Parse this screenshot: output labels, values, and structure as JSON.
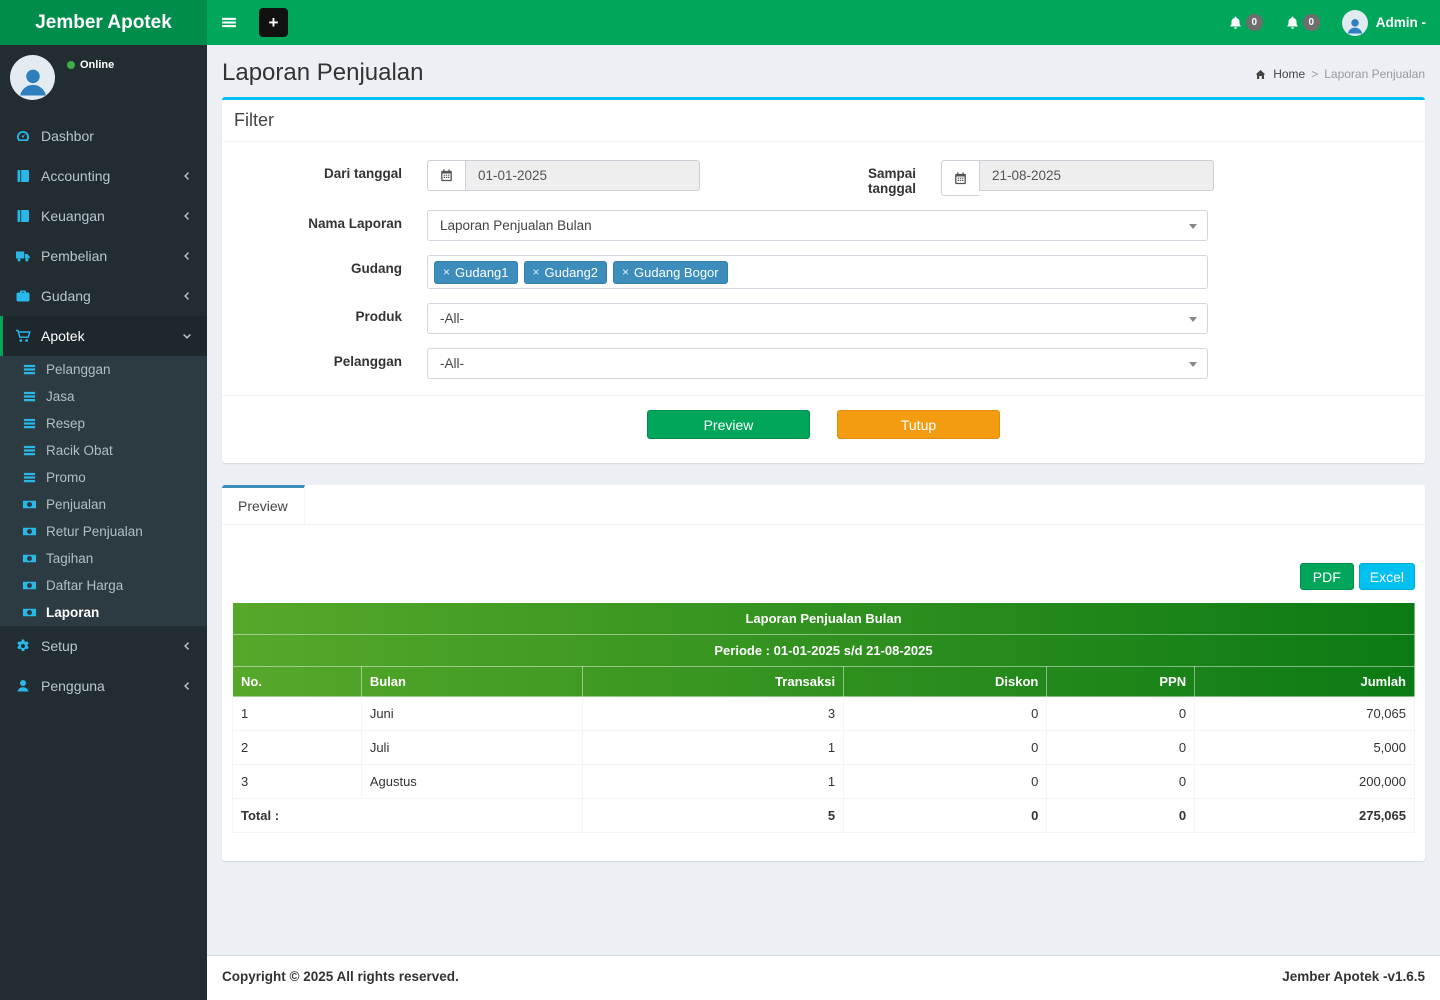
{
  "brand": {
    "name": "Jember Apotek"
  },
  "navbar": {
    "plus_label": "+",
    "notif_bell_count": "0",
    "notif_alert_count": "0",
    "user_label": "Admin -"
  },
  "sidebar": {
    "status": "Online",
    "items": [
      {
        "label": "Dashbor",
        "icon": "dashboard-icon"
      },
      {
        "label": "Accounting",
        "icon": "book-icon"
      },
      {
        "label": "Keuangan",
        "icon": "book-icon"
      },
      {
        "label": "Pembelian",
        "icon": "truck-icon"
      },
      {
        "label": "Gudang",
        "icon": "briefcase-icon"
      },
      {
        "label": "Apotek",
        "icon": "cart-icon"
      },
      {
        "label": "Setup",
        "icon": "gears-icon"
      },
      {
        "label": "Pengguna",
        "icon": "user-icon"
      }
    ],
    "submenu": [
      "Pelanggan",
      "Jasa",
      "Resep",
      "Racik Obat",
      "Promo",
      "Penjualan",
      "Retur Penjualan",
      "Tagihan",
      "Daftar Harga",
      "Laporan"
    ]
  },
  "page": {
    "title": "Laporan Penjualan",
    "breadcrumb_home": "Home",
    "breadcrumb_sep": ">",
    "breadcrumb_current": "Laporan Penjualan"
  },
  "filter": {
    "box_title": "Filter",
    "from_label": "Dari tanggal",
    "from_value": "01-01-2025",
    "to_label": "Sampai tanggal",
    "to_value": "21-08-2025",
    "report_name_label": "Nama Laporan",
    "report_name_value": "Laporan Penjualan Bulan",
    "warehouse_label": "Gudang",
    "warehouse_tags": [
      "Gudang1",
      "Gudang2",
      "Gudang Bogor"
    ],
    "product_label": "Produk",
    "product_value": "-All-",
    "customer_label": "Pelanggan",
    "customer_value": "-All-",
    "preview_button": "Preview",
    "close_button": "Tutup"
  },
  "preview": {
    "tab_label": "Preview",
    "pdf_button": "PDF",
    "excel_button": "Excel",
    "report": {
      "title": "Laporan Penjualan Bulan",
      "periode": "Periode : 01-01-2025 s/d 21-08-2025",
      "columns": [
        "No.",
        "Bulan",
        "Transaksi",
        "Diskon",
        "PPN",
        "Jumlah"
      ],
      "rows": [
        [
          "1",
          "Juni",
          "3",
          "0",
          "0",
          "70,065"
        ],
        [
          "2",
          "Juli",
          "1",
          "0",
          "0",
          "5,000"
        ],
        [
          "3",
          "Agustus",
          "1",
          "0",
          "0",
          "200,000"
        ]
      ],
      "total": {
        "label": "Total :",
        "transaksi": "5",
        "diskon": "0",
        "ppn": "0",
        "jumlah": "275,065"
      }
    }
  },
  "footer": {
    "left": "Copyright © 2025 All rights reserved.",
    "right": "Jember Apotek -v1.6.5"
  },
  "colors": {
    "navbar_green": "#00a65a",
    "logo_green": "#008d4c",
    "sidebar_dark": "#222d32",
    "sidebar_icon_blue": "#29b8e8",
    "filter_box_accent": "#00c0ef",
    "tab_accent": "#3c8dbc",
    "tag_blue": "#3c8dbc",
    "button_orange": "#f39c12",
    "excel_cyan": "#00c0ef",
    "table_header_gradient": [
      "#56a82a",
      "#0c7a14"
    ]
  }
}
